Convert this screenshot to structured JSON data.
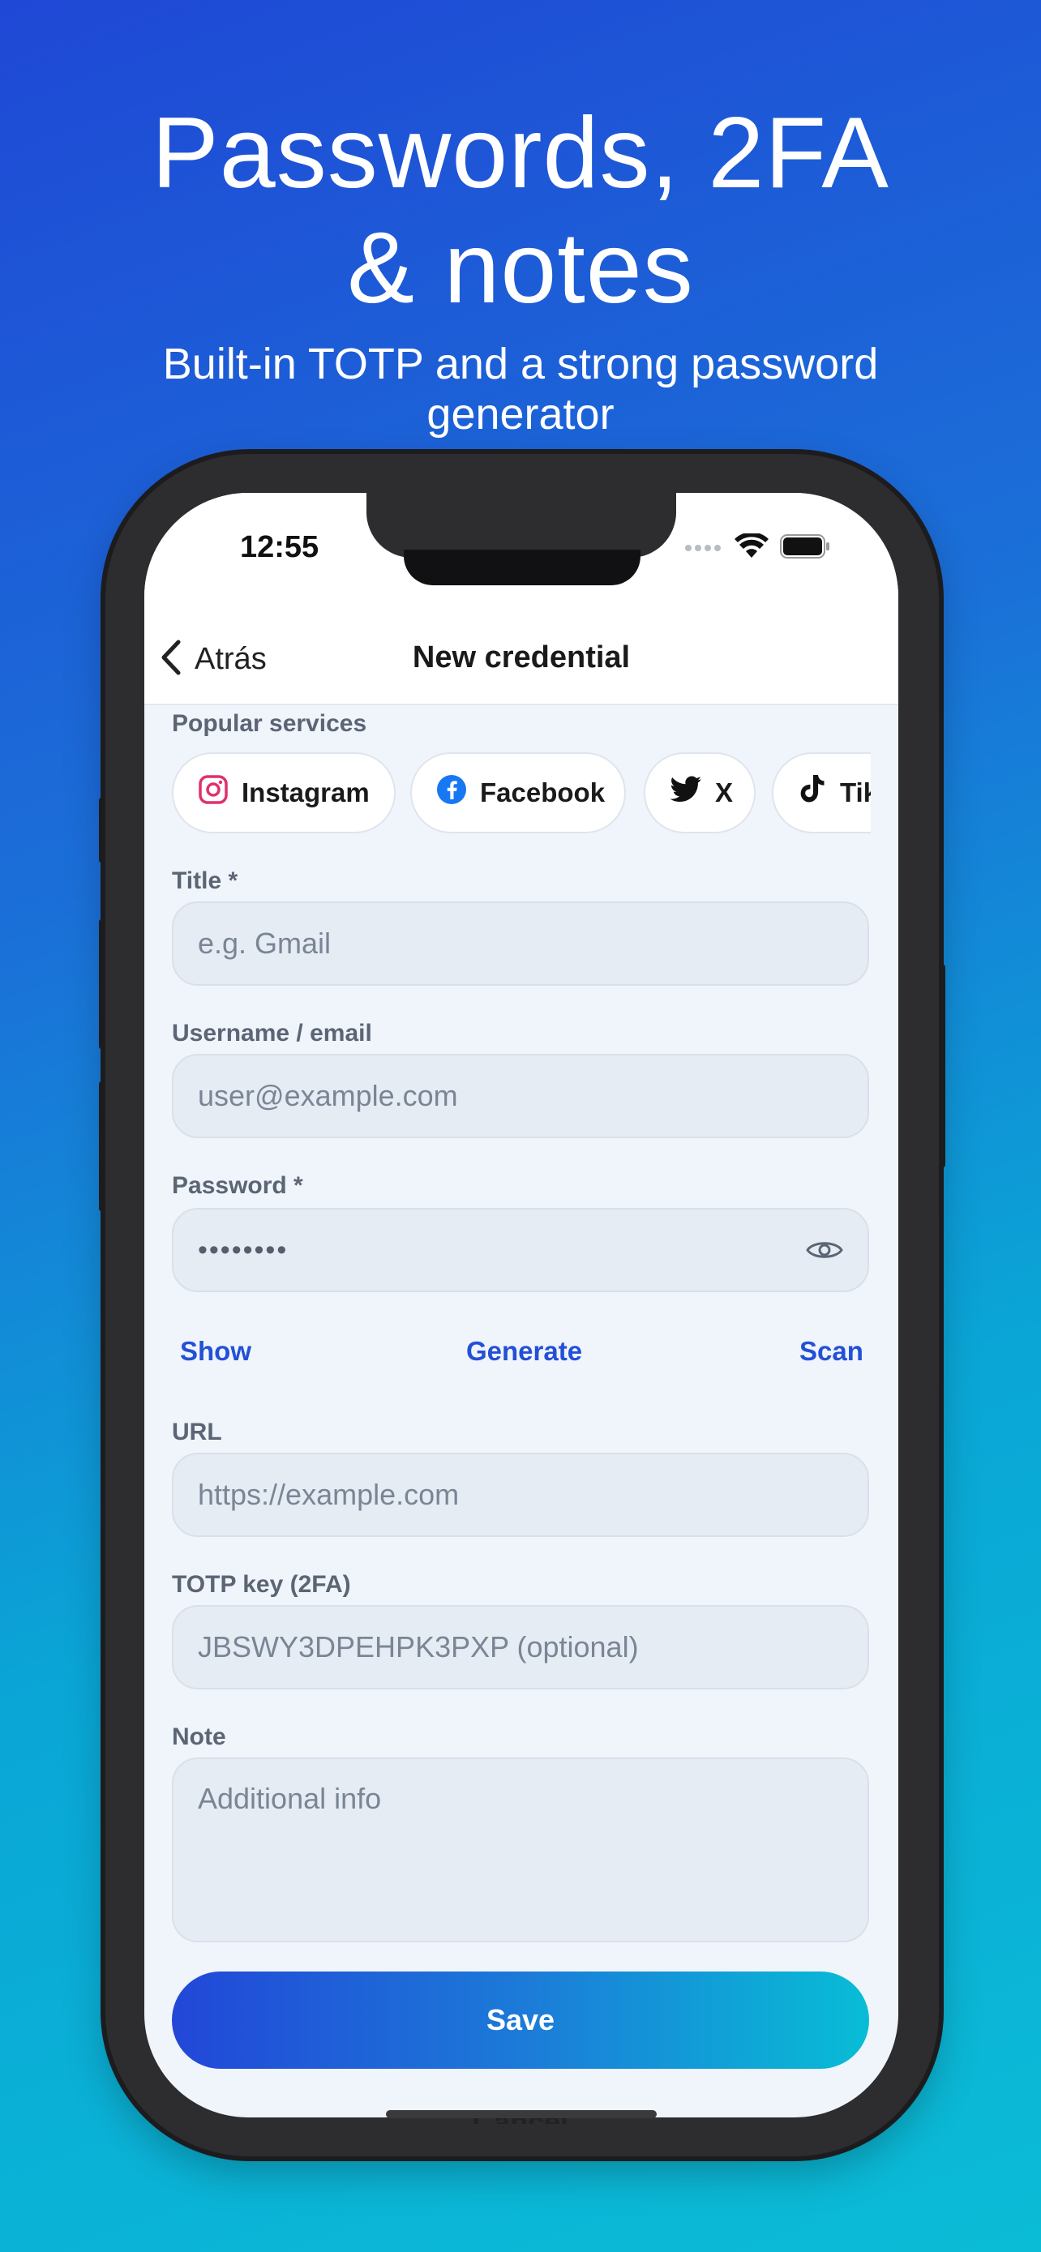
{
  "hero": {
    "title_line1": "Passwords, 2FA",
    "title_line2": "& notes",
    "subtitle_line1": "Built-in TOTP and a strong password",
    "subtitle_line2": "generator"
  },
  "status_bar": {
    "time": "12:55",
    "icons": [
      "signal-dots-icon",
      "wifi-icon",
      "battery-icon"
    ]
  },
  "nav": {
    "back_label": "Atrás",
    "title": "New credential"
  },
  "popular_services": {
    "label": "Popular services",
    "chips": [
      {
        "label": "Instagram",
        "icon": "instagram-icon"
      },
      {
        "label": "Facebook",
        "icon": "facebook-icon"
      },
      {
        "label": "X",
        "icon": "twitter-icon"
      },
      {
        "label": "TikTok",
        "icon": "tiktok-icon"
      }
    ]
  },
  "form": {
    "title": {
      "label": "Title *",
      "placeholder": "e.g. Gmail"
    },
    "username": {
      "label": "Username / email",
      "placeholder": "user@example.com"
    },
    "password": {
      "label": "Password *",
      "value": "••••••••",
      "icon": "eye-icon"
    },
    "password_actions": {
      "show": "Show",
      "generate": "Generate",
      "scan": "Scan"
    },
    "url": {
      "label": "URL",
      "placeholder": "https://example.com"
    },
    "totp": {
      "label": "TOTP key (2FA)",
      "placeholder": "JBSWY3DPEHPK3PXP (optional)"
    },
    "note": {
      "label": "Note",
      "placeholder": "Additional info"
    }
  },
  "actions": {
    "save": "Save",
    "cancel": "Cancel"
  },
  "colors": {
    "accent": "#2350d6",
    "gradient_start": "#2247d8",
    "gradient_end": "#08bdd6"
  }
}
